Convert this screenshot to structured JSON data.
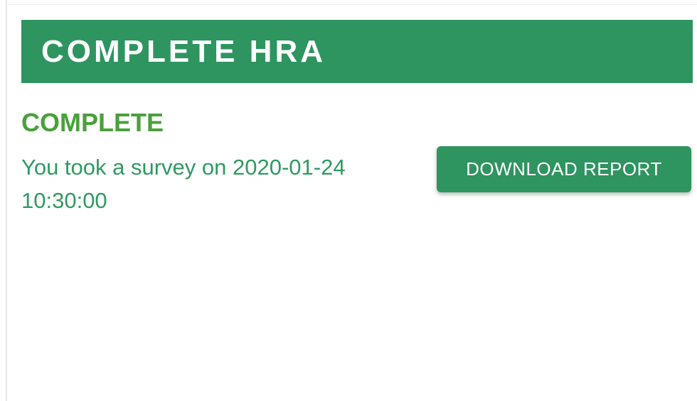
{
  "header": {
    "title": "COMPLETE HRA"
  },
  "status": {
    "heading": "COMPLETE",
    "survey_line": "You took a survey on 2020-01-24 10:30:00"
  },
  "actions": {
    "download_label": "DOWNLOAD REPORT"
  },
  "colors": {
    "brand_green": "#2e9460",
    "status_green": "#4aa03c",
    "text_green": "#2f9a62"
  }
}
